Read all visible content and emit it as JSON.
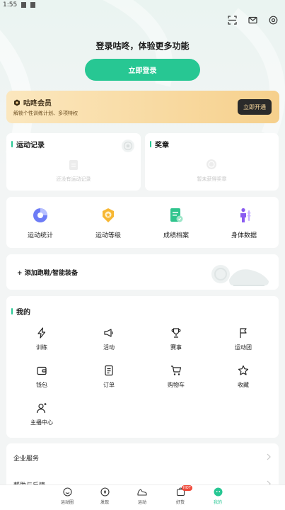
{
  "status_bar": {
    "time": "1:55"
  },
  "login": {
    "prompt": "登录咕咚，体验更多功能",
    "button_label": "立即登录"
  },
  "vip": {
    "title": "咕咚会员",
    "subtitle": "解锁个性训练计划、多项特权",
    "button_label": "立即开通"
  },
  "records": {
    "title": "运动记录",
    "empty_text": "还没有运动记录"
  },
  "medals": {
    "title": "奖章",
    "empty_text": "暂未获得奖章"
  },
  "features": [
    {
      "label": "运动统计",
      "icon": "stats-pie-icon"
    },
    {
      "label": "运动等级",
      "icon": "level-badge-icon"
    },
    {
      "label": "成绩档案",
      "icon": "record-file-icon"
    },
    {
      "label": "身体数据",
      "icon": "body-data-icon"
    }
  ],
  "device": {
    "label": "添加跑鞋/智能装备"
  },
  "mine": {
    "title": "我的",
    "items": [
      {
        "label": "训练",
        "icon": "lightning-icon"
      },
      {
        "label": "活动",
        "icon": "megaphone-icon"
      },
      {
        "label": "赛事",
        "icon": "trophy-icon"
      },
      {
        "label": "运动团",
        "icon": "flag-icon"
      },
      {
        "label": "钱包",
        "icon": "wallet-icon"
      },
      {
        "label": "订单",
        "icon": "order-icon"
      },
      {
        "label": "购物车",
        "icon": "cart-icon"
      },
      {
        "label": "收藏",
        "icon": "star-icon"
      },
      {
        "label": "主播中心",
        "icon": "anchor-user-icon"
      }
    ]
  },
  "list": [
    {
      "label": "企业服务"
    },
    {
      "label": "帮助与反馈"
    }
  ],
  "tabs": [
    {
      "label": "运动圈",
      "icon": "chat-bubble-icon"
    },
    {
      "label": "发现",
      "icon": "compass-icon"
    },
    {
      "label": "运动",
      "icon": "shoe-icon"
    },
    {
      "label": "好货",
      "icon": "shop-icon",
      "badge": "HOT"
    },
    {
      "label": "我的",
      "icon": "me-icon",
      "active": true
    }
  ],
  "colors": {
    "accent": "#27c793",
    "vip_gold": "#f6d08c",
    "hot_badge": "#f04a3b"
  }
}
